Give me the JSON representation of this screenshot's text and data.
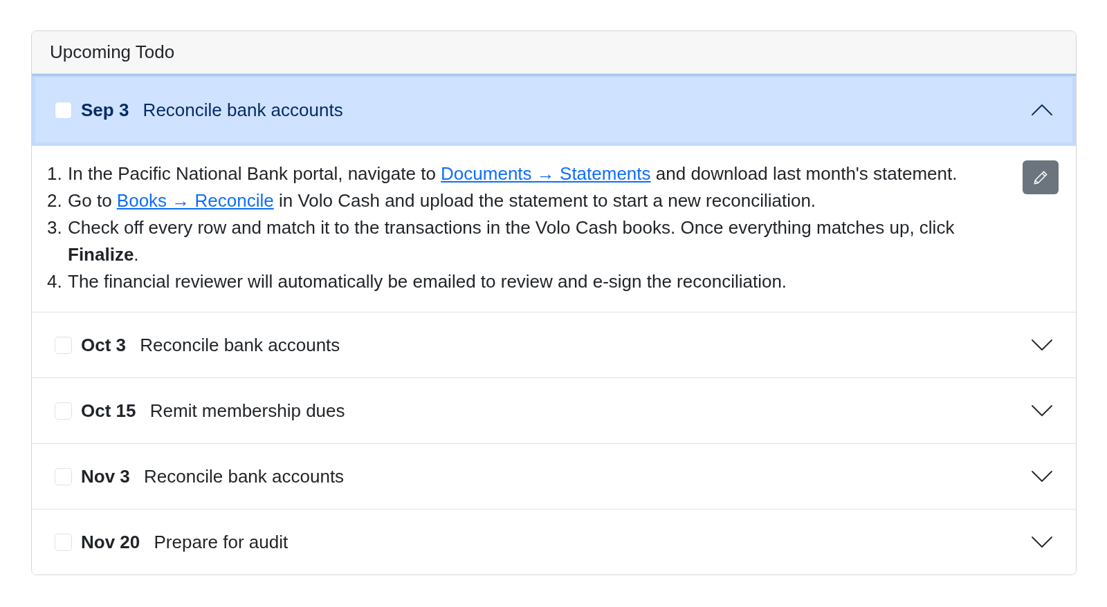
{
  "card": {
    "title": "Upcoming Todo"
  },
  "todos": [
    {
      "date": "Sep 3",
      "title": "Reconcile bank accounts",
      "checked": false,
      "expanded": true,
      "steps": [
        {
          "number": "1.",
          "parts": [
            {
              "kind": "text",
              "text": "In the Pacific National Bank portal, navigate to "
            },
            {
              "kind": "link",
              "text": "Documents → Statements"
            },
            {
              "kind": "text",
              "text": " and download last month's statement."
            }
          ]
        },
        {
          "number": "2.",
          "parts": [
            {
              "kind": "text",
              "text": "Go to "
            },
            {
              "kind": "link",
              "text": "Books → Reconcile"
            },
            {
              "kind": "text",
              "text": " in Volo Cash and upload the statement to start a new reconciliation."
            }
          ]
        },
        {
          "number": "3.",
          "parts": [
            {
              "kind": "text",
              "text": "Check off every row and match it to the transactions in the Volo Cash books. Once everything matches up, click **Finalize**."
            }
          ]
        },
        {
          "number": "4.",
          "parts": [
            {
              "kind": "text",
              "text": "The financial reviewer will automatically be emailed to review and e-sign the reconciliation."
            }
          ]
        }
      ]
    },
    {
      "date": "Oct 3",
      "title": "Reconcile bank accounts",
      "checked": false,
      "expanded": false
    },
    {
      "date": "Oct 15",
      "title": "Remit membership dues",
      "checked": false,
      "expanded": false
    },
    {
      "date": "Nov 3",
      "title": "Reconcile bank accounts",
      "checked": false,
      "expanded": false
    },
    {
      "date": "Nov 20",
      "title": "Prepare for audit",
      "checked": false,
      "expanded": false
    }
  ]
}
